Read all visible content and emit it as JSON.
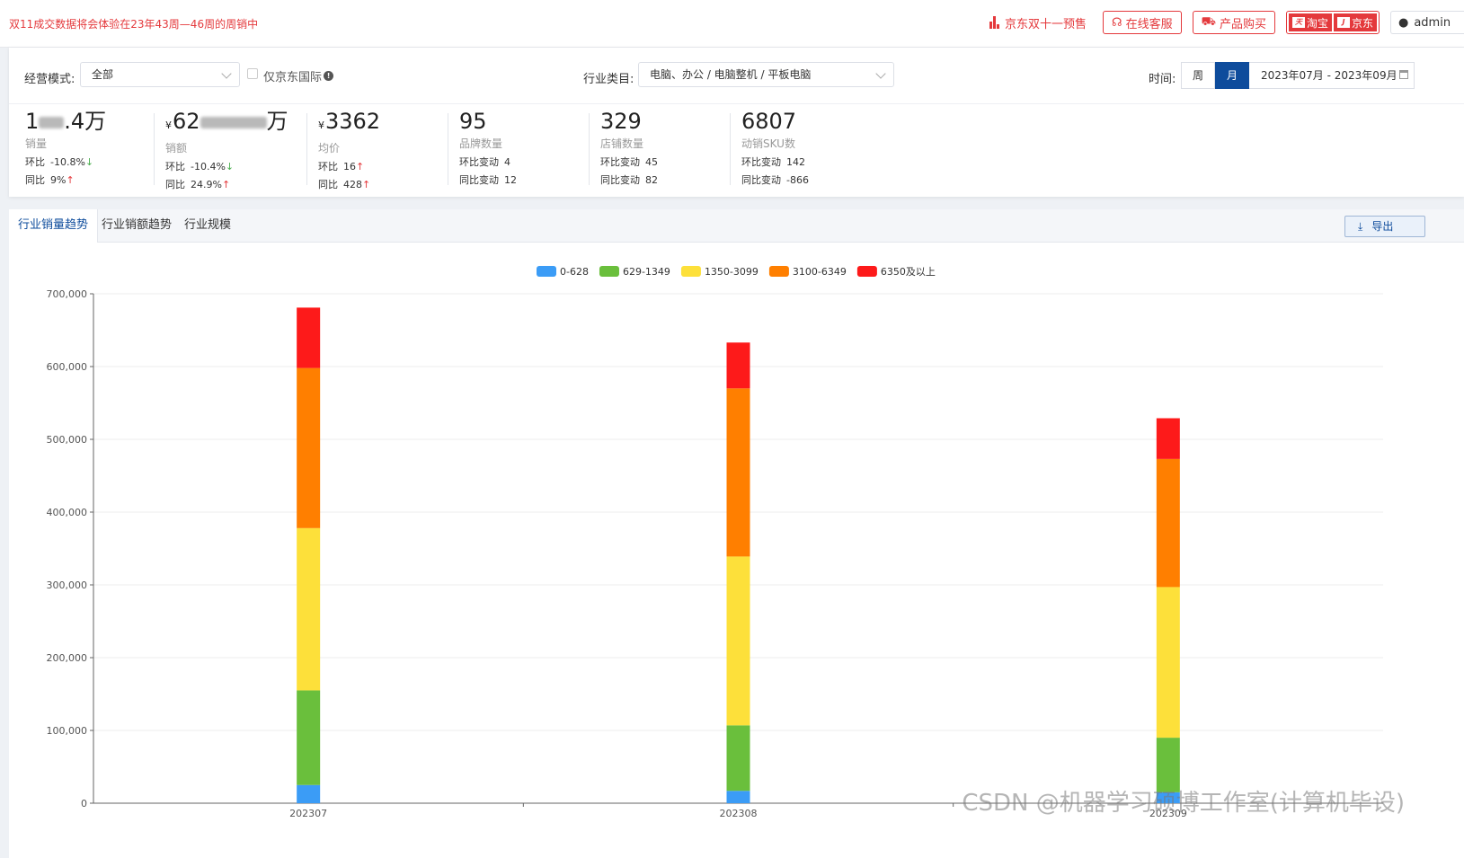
{
  "topbar": {
    "notice": "双11成交数据将会体验在23年43周—46周的周销中",
    "jd_presale": "京东双十一预售",
    "online_service": "在线客服",
    "product_buy": "产品购买",
    "taobao": "淘宝",
    "jd": "京东",
    "user": "admin"
  },
  "filters": {
    "mode_label": "经营模式:",
    "mode_value": "全部",
    "jd_intl_label": "仅京东国际",
    "category_label": "行业类目:",
    "category_value": "电脑、办公 / 电脑整机 / 平板电脑",
    "time_label": "时间:",
    "period_week": "周",
    "period_month": "月",
    "date_range": "2023年07月 - 2023年09月"
  },
  "stats": [
    {
      "value_prefix": "1",
      "value_suffix": ".4万",
      "label": "销量",
      "l1_key": "环比",
      "l1_val": "-10.8%",
      "l1_dir": "↓",
      "l2_key": "同比",
      "l2_val": "9%",
      "l2_dir": "↑"
    },
    {
      "yen": "¥",
      "value_prefix": "62",
      "value_suffix": "万",
      "label": "销额",
      "l1_key": "环比",
      "l1_val": "-10.4%",
      "l1_dir": "↓",
      "l2_key": "同比",
      "l2_val": "24.9%",
      "l2_dir": "↑"
    },
    {
      "yen": "¥",
      "value": "3362",
      "label": "均价",
      "l1_key": "环比",
      "l1_val": "16",
      "l1_dir": "↑",
      "l2_key": "同比",
      "l2_val": "428",
      "l2_dir": "↑"
    },
    {
      "value": "95",
      "label": "品牌数量",
      "l1_key": "环比变动",
      "l1_val": "4",
      "l2_key": "同比变动",
      "l2_val": "12"
    },
    {
      "value": "329",
      "label": "店铺数量",
      "l1_key": "环比变动",
      "l1_val": "45",
      "l2_key": "同比变动",
      "l2_val": "82"
    },
    {
      "value": "6807",
      "label": "动销SKU数",
      "l1_key": "环比变动",
      "l1_val": "142",
      "l2_key": "同比变动",
      "l2_val": "-866"
    }
  ],
  "tabs": [
    "行业销量趋势",
    "行业销额趋势",
    "行业规模"
  ],
  "export_label": "导出",
  "watermark": "CSDN @机器学习硕博工作室(计算机毕设)",
  "chart_data": {
    "type": "bar",
    "stacked": true,
    "categories": [
      "202307",
      "202308",
      "202309"
    ],
    "series": [
      {
        "name": "0-628",
        "color": "#3b9cf6",
        "values": [
          25000,
          17000,
          15000
        ]
      },
      {
        "name": "629-1349",
        "color": "#6abf3c",
        "values": [
          130000,
          90000,
          75000
        ]
      },
      {
        "name": "1350-3099",
        "color": "#fde03a",
        "values": [
          223000,
          232000,
          207000
        ]
      },
      {
        "name": "3100-6349",
        "color": "#ff7f00",
        "values": [
          220000,
          231000,
          176000
        ]
      },
      {
        "name": "6350及以上",
        "color": "#fd1a1a",
        "values": [
          83000,
          63000,
          56000
        ]
      }
    ],
    "ylim": [
      0,
      700000
    ],
    "yticks": [
      "0",
      "100,000",
      "200,000",
      "300,000",
      "400,000",
      "500,000",
      "600,000",
      "700,000"
    ],
    "grid": true,
    "legend_position": "top-center"
  }
}
